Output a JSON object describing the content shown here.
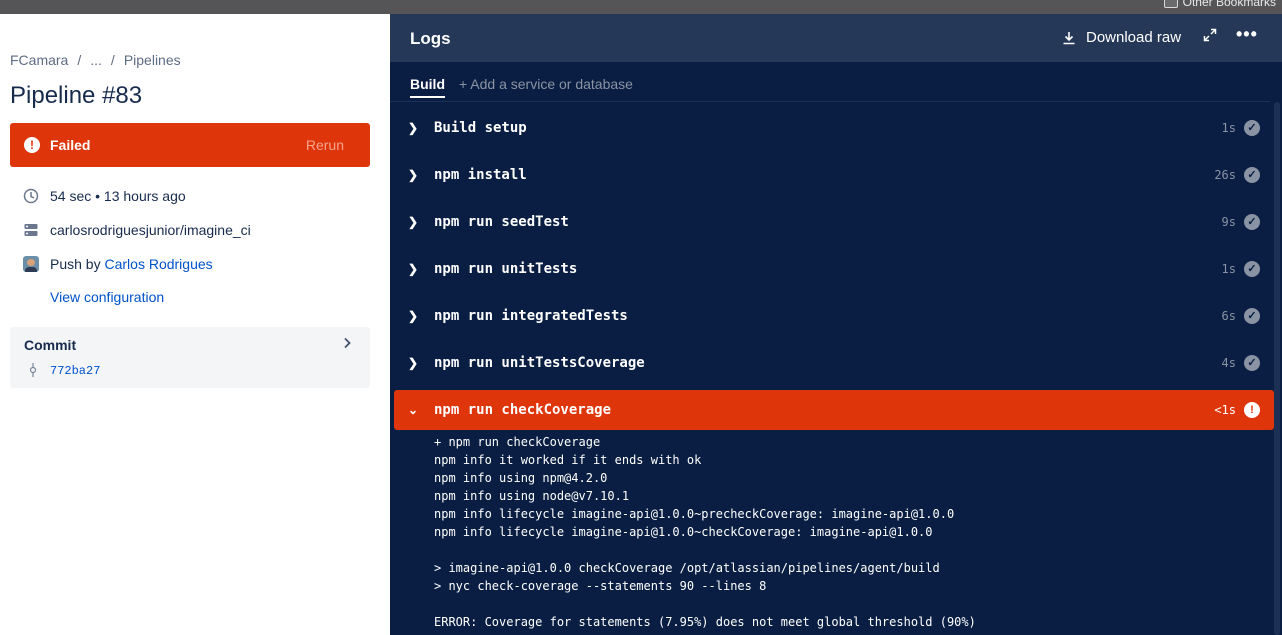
{
  "browser": {
    "bookmarks_label": "Other Bookmarks"
  },
  "breadcrumb": {
    "workspace": "FCamara",
    "sep1": "/",
    "ellipsis": "...",
    "sep2": "/",
    "section": "Pipelines"
  },
  "pipeline": {
    "title": "Pipeline #83",
    "status": "Failed",
    "rerun_label": "Rerun",
    "duration": "54 sec • 13 hours ago",
    "repo": "carlosrodriguesjunior/imagine_ci",
    "trigger_prefix": "Push by",
    "trigger_user": "Carlos Rodrigues",
    "view_config": "View configuration",
    "status_color": "#de350b"
  },
  "commit": {
    "label": "Commit",
    "hash": "772ba27"
  },
  "logs": {
    "title": "Logs",
    "download_label": "Download raw",
    "tabs": {
      "active": "Build",
      "add": "+ Add a service or database"
    },
    "steps": [
      {
        "name": "Build setup",
        "duration": "1s",
        "status": "passed"
      },
      {
        "name": "npm install",
        "duration": "26s",
        "status": "passed"
      },
      {
        "name": "npm run seedTest",
        "duration": "9s",
        "status": "passed"
      },
      {
        "name": "npm run unitTests",
        "duration": "1s",
        "status": "passed"
      },
      {
        "name": "npm run integratedTests",
        "duration": "6s",
        "status": "passed"
      },
      {
        "name": "npm run unitTestsCoverage",
        "duration": "4s",
        "status": "passed"
      },
      {
        "name": "npm run checkCoverage",
        "duration": "<1s",
        "status": "failed"
      }
    ],
    "output": [
      "+ npm run checkCoverage",
      "npm info it worked if it ends with ok",
      "npm info using npm@4.2.0",
      "npm info using node@v7.10.1",
      "npm info lifecycle imagine-api@1.0.0~precheckCoverage: imagine-api@1.0.0",
      "npm info lifecycle imagine-api@1.0.0~checkCoverage: imagine-api@1.0.0",
      "",
      "> imagine-api@1.0.0 checkCoverage /opt/atlassian/pipelines/agent/build",
      "> nyc check-coverage --statements 90 --lines 8",
      "",
      "ERROR: Coverage for statements (7.95%) does not meet global threshold (90%)"
    ]
  }
}
